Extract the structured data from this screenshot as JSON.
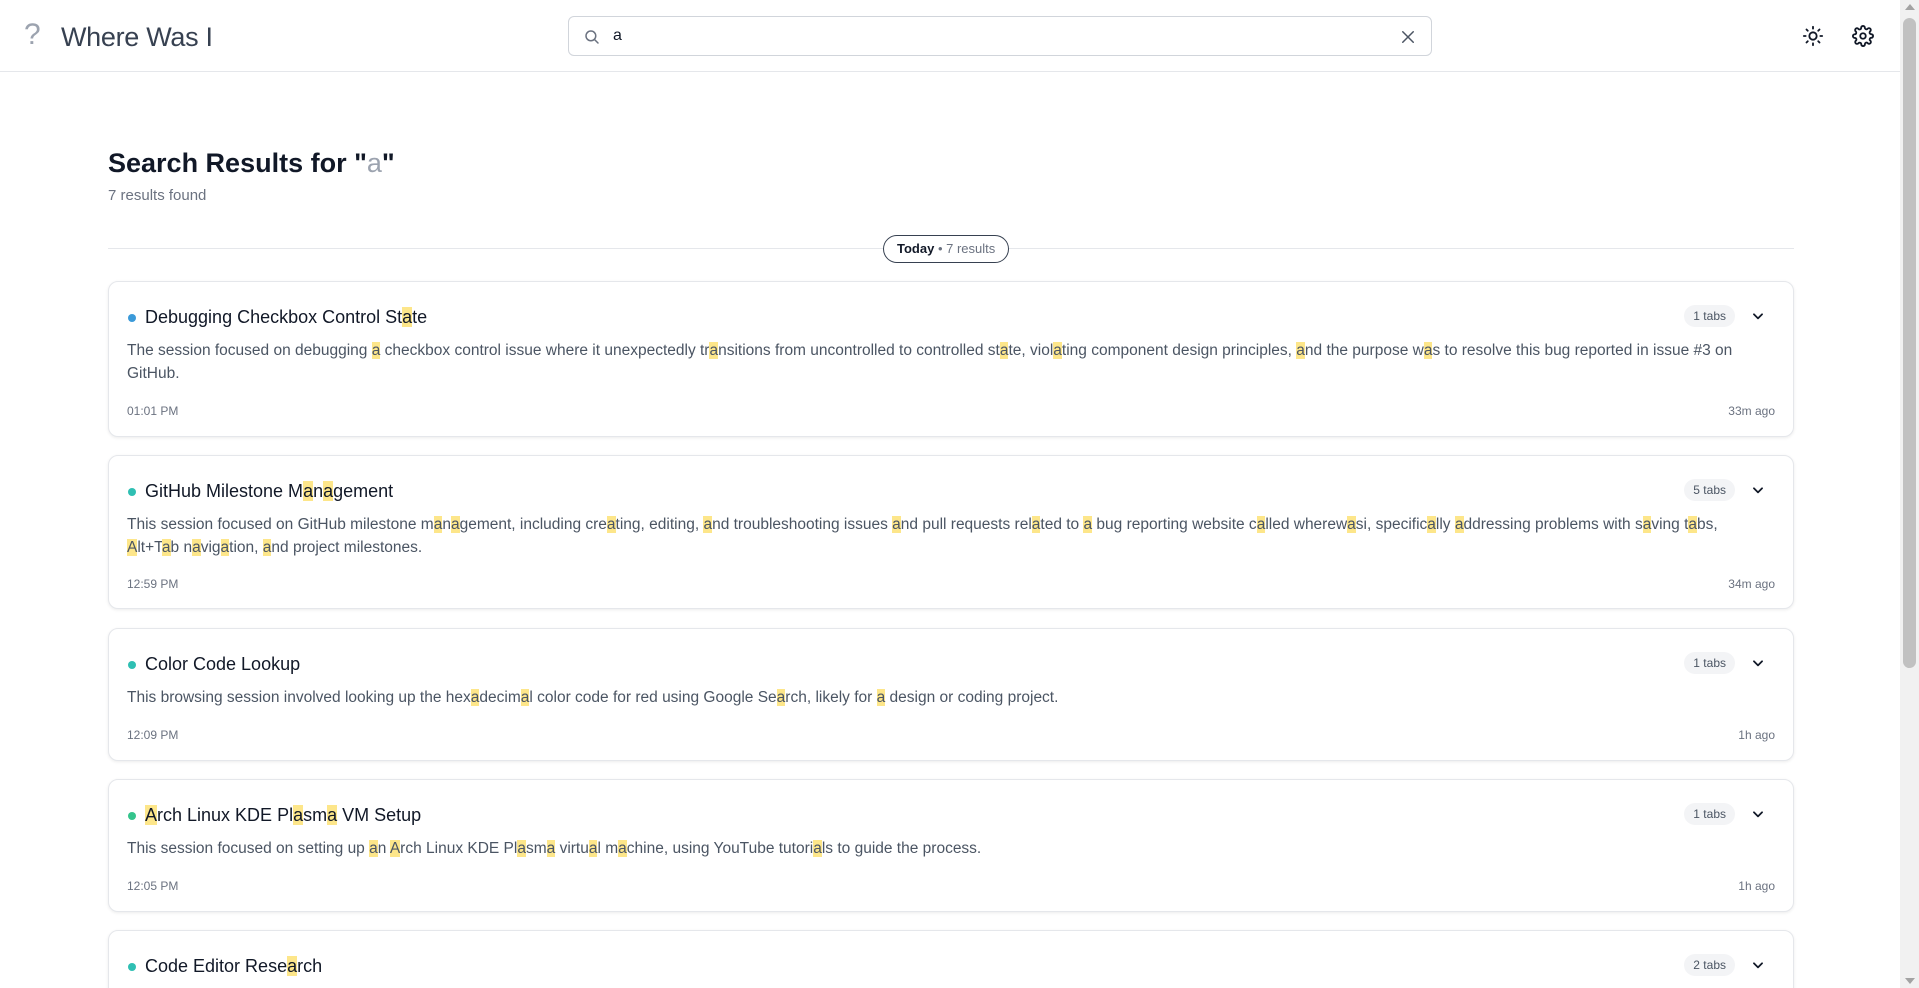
{
  "app": {
    "logo_glyph": "?",
    "title": "Where Was I"
  },
  "search": {
    "value": "a",
    "placeholder": ""
  },
  "results": {
    "heading_prefix": "Search Results for \"",
    "query": "a",
    "heading_suffix": "\"",
    "count_text": "7 results found"
  },
  "group": {
    "day": "Today",
    "sep": " • 7 results"
  },
  "colors": {
    "dot_blue": "#3b9ad9",
    "dot_teal": "#2fbfb3",
    "dot_green": "#34c48c",
    "highlight": "#fde68a"
  },
  "cards": [
    {
      "title": "Debugging Checkbox Control State",
      "tabs": "1 tabs",
      "description": "The session focused on debugging a checkbox control issue where it unexpectedly transitions from uncontrolled to controlled state, violating component design principles, and the purpose was to resolve this bug reported in issue #3 on GitHub.",
      "time": "01:01 PM",
      "ago": "33m ago",
      "dot_color": "#3b9ad9"
    },
    {
      "title": "GitHub Milestone Management",
      "tabs": "5 tabs",
      "description": "This session focused on GitHub milestone management, including creating, editing, and troubleshooting issues and pull requests related to a bug reporting website called wherewasi, specifically addressing problems with saving tabs, Alt+Tab navigation, and project milestones.",
      "time": "12:59 PM",
      "ago": "34m ago",
      "dot_color": "#2fbfb3"
    },
    {
      "title": "Color Code Lookup",
      "tabs": "1 tabs",
      "description": "This browsing session involved looking up the hexadecimal color code for red using Google Search, likely for a design or coding project.",
      "time": "12:09 PM",
      "ago": "1h ago",
      "dot_color": "#2fbfb3"
    },
    {
      "title": "Arch Linux KDE Plasma VM Setup",
      "tabs": "1 tabs",
      "description": "This session focused on setting up an Arch Linux KDE Plasma virtual machine, using YouTube tutorials to guide the process.",
      "time": "12:05 PM",
      "ago": "1h ago",
      "dot_color": "#34c48c"
    },
    {
      "title": "Code Editor Research",
      "tabs": "2 tabs",
      "description": "",
      "time": "",
      "ago": "",
      "dot_color": "#2fbfb3"
    }
  ]
}
